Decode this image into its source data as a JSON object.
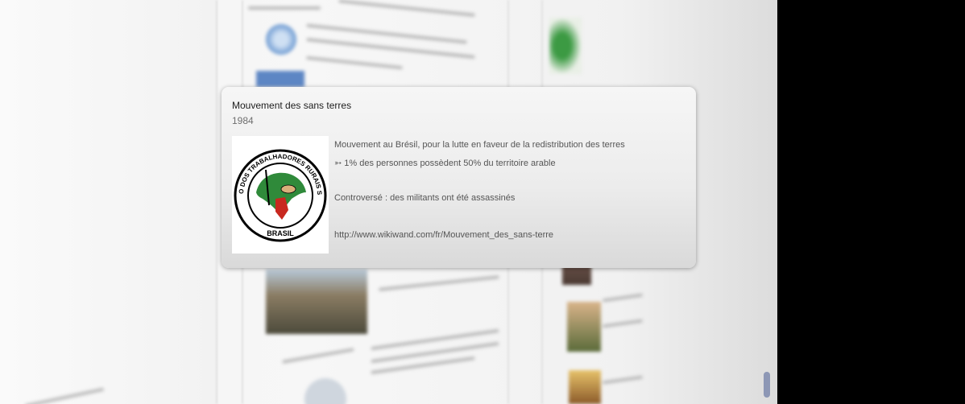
{
  "popup": {
    "title": "Mouvement des sans terres",
    "year": "1984",
    "logo": {
      "ring_text": "MOVIMENTO DOS TRABALHADORES RURAIS SEM TERRA",
      "bottom_text": "BRASIL"
    },
    "lines": [
      "Mouvement au Brésil, pour la lutte en faveur de la redistribution des terres",
      "➳ 1% des personnes possèdent 50% du territoire arable",
      "Controversé : des militants ont été assassinés",
      "http://www.wikiwand.com/fr/Mouvement_des_sans-terre"
    ]
  },
  "colors": {
    "logo_green": "#2f8a3a",
    "logo_red": "#c8281f",
    "card_bg": "#ececec"
  }
}
